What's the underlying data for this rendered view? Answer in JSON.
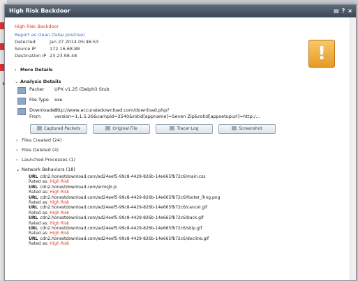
{
  "window": {
    "title": "High Risk Backdoor"
  },
  "alert": {
    "title": "High Risk Backdoor",
    "report_link": "Report as clean (false positive)",
    "fields": [
      {
        "label": "Detected",
        "value": "Jan 27 2014 05:46:53"
      },
      {
        "label": "Source IP",
        "value": "172.16.68.88"
      },
      {
        "label": "Destination IP",
        "value": "23.23.98.48"
      }
    ]
  },
  "sections": {
    "more_details": "More Details",
    "analysis_details": "Analysis Details"
  },
  "analysis": {
    "packer_label": "Packer",
    "packer_value": "UPX v1.25 (Delphi) Stub",
    "file_type_label": "File Type",
    "file_type_value": "exe",
    "downloaded_label_1": "Downloaded",
    "downloaded_label_2": "From",
    "downloaded_value_1": "http://www.accuratedownload.com/download.php?",
    "downloaded_value_2": "version=1.1.5.26&campid=2540&rotid[appname]=Seven Zip&rotid[appsetupurl]=http:/..."
  },
  "buttons": {
    "captured_packets": "Captured Packets",
    "original_file": "Original File",
    "tracer_log": "Tracer Log",
    "screenshot": "Screenshot"
  },
  "collapsibles": {
    "files_created": "Files Created (24)",
    "files_deleted": "Files Deleted (4)",
    "launched_processes": "Launched Processes (1)"
  },
  "network": {
    "header": "Network Behaviors (18)",
    "url_label": "URL",
    "rated_label": "Rated as:",
    "rating": "High Risk",
    "items": [
      "cdn2.honestdownload.com/ad24eef5-99c8-4429-826b-14e665fb72c6/main.css",
      "cdn2.honestdownload.com/ermsjb.js",
      "cdn2.honestdownload.com/ad24eef5-99c8-4429-826b-14e665fb72c6/footer_lhng.png",
      "cdn2.honestdownload.com/ad24eef5-99c8-4429-826b-14e665fb72c6/cancel.gif",
      "cdn2.honestdownload.com/ad24eef5-99c8-4429-826b-14e665fb72c6/back.gif",
      "cdn2.honestdownload.com/ad24eef5-99c8-4429-826b-14e665fb72c6/skip.gif",
      "cdn2.honestdownload.com/ad24eef5-99c8-4429-826b-14e665fb72c6/decline.gif"
    ]
  }
}
